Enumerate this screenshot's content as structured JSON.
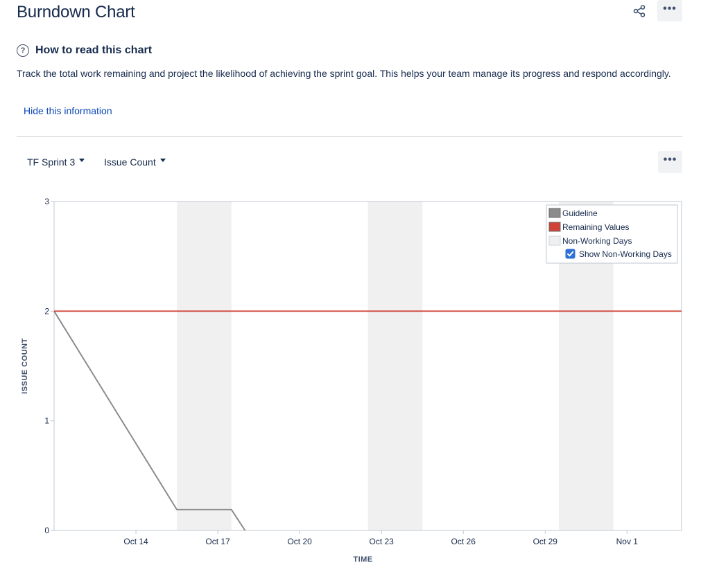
{
  "page": {
    "title": "Burndown Chart"
  },
  "info": {
    "title": "How to read this chart",
    "description": "Track the total work remaining and project the likelihood of achieving the sprint goal. This helps your team manage its progress and respond accordingly.",
    "hide_link": "Hide this information"
  },
  "toolbar": {
    "sprint_selected": "TF Sprint 3",
    "metric_selected": "Issue Count",
    "help_glyph": "?",
    "more_glyph": "•••"
  },
  "icons": {
    "share": "share-icon",
    "more": "more-icon",
    "help": "question-circle-icon",
    "caret": "chevron-down-icon",
    "checkbox": "check-icon"
  },
  "colors": {
    "guideline": "#8c8c8c",
    "remaining": "#d04437",
    "non_working": "#f0f0f0",
    "link": "#0c48b8",
    "checkbox": "#2e6fd8"
  },
  "chart_data": {
    "type": "line",
    "xlabel": "TIME",
    "ylabel": "ISSUE COUNT",
    "xlim": [
      "Oct 11",
      "Nov 3"
    ],
    "ylim": [
      0,
      3
    ],
    "x_ticks": [
      "Oct 14",
      "Oct 17",
      "Oct 20",
      "Oct 23",
      "Oct 26",
      "Oct 29",
      "Nov 1"
    ],
    "x_tick_days": [
      3,
      6,
      9,
      12,
      15,
      18,
      21
    ],
    "y_ticks": [
      0,
      1,
      2,
      3
    ],
    "x_start_day": 0,
    "x_end_day": 23,
    "grid": false,
    "legend_position": "top-right",
    "non_working_days": [
      {
        "start": "Oct 15",
        "end": "Oct 17",
        "start_day": 4.5,
        "end_day": 6.5
      },
      {
        "start": "Oct 22",
        "end": "Oct 24",
        "start_day": 11.5,
        "end_day": 13.5
      },
      {
        "start": "Oct 29",
        "end": "Oct 31",
        "start_day": 18.5,
        "end_day": 20.5
      }
    ],
    "series": [
      {
        "name": "Guideline",
        "points": [
          [
            0,
            2
          ],
          [
            4.5,
            0.19
          ],
          [
            6.5,
            0.19
          ],
          [
            7.0,
            0
          ]
        ]
      },
      {
        "name": "Remaining Values",
        "points": [
          [
            0,
            2
          ],
          [
            23,
            2
          ]
        ]
      }
    ],
    "legend": {
      "items": [
        "Guideline",
        "Remaining Values",
        "Non-Working Days"
      ],
      "checkbox_label": "Show Non-Working Days",
      "checkbox_checked": true
    }
  }
}
